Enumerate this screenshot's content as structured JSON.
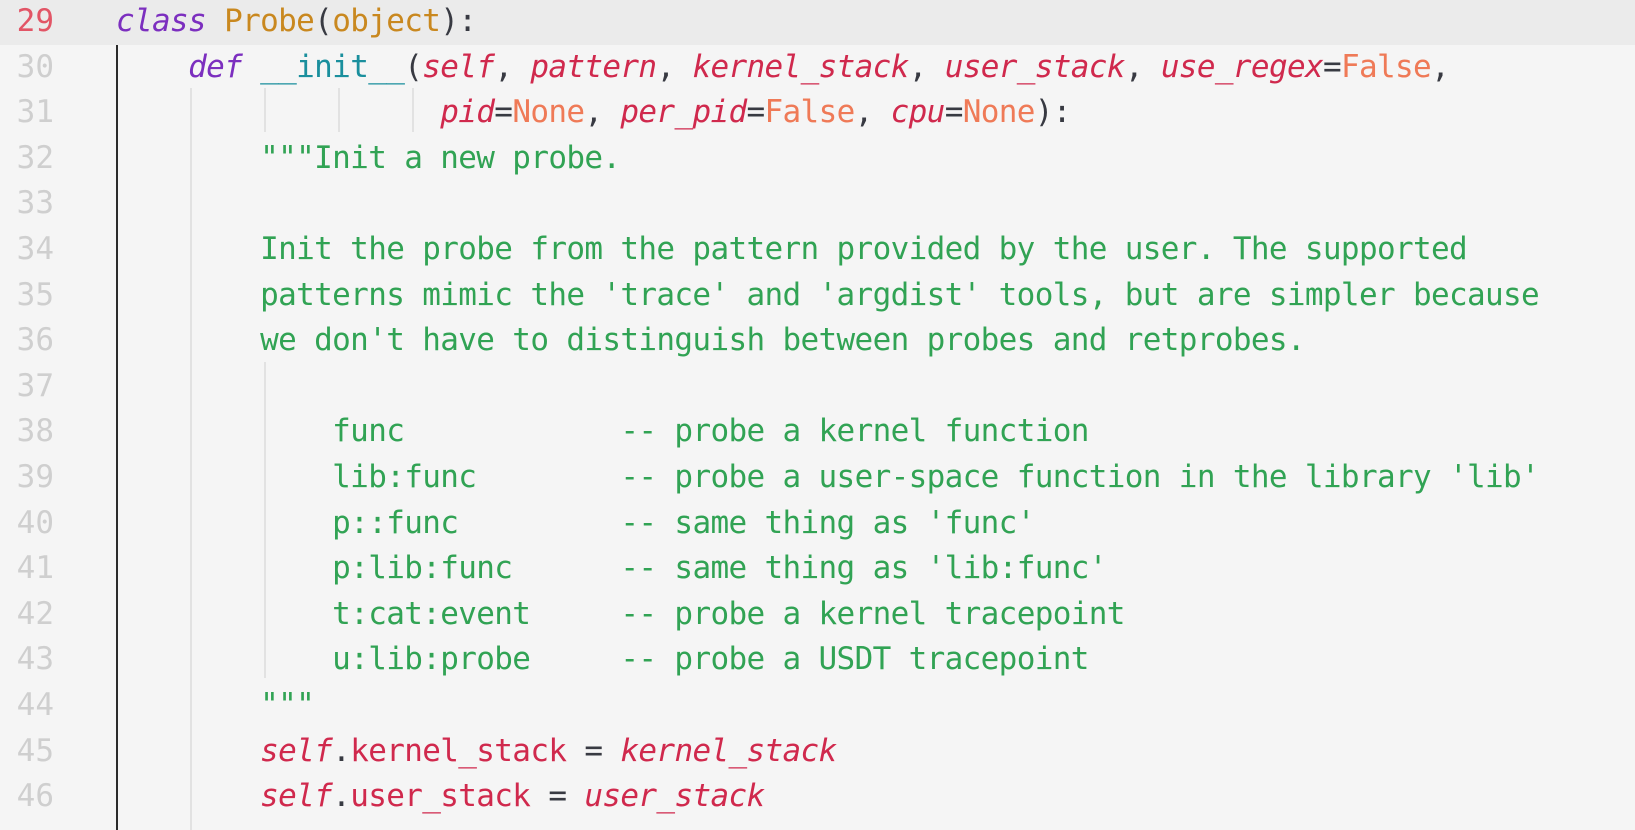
{
  "editor": {
    "active_line": 29,
    "lines": [
      {
        "num": "29",
        "tokens": [
          {
            "t": "class",
            "c": "kw"
          },
          {
            "t": " "
          },
          {
            "t": "Probe",
            "c": "cls"
          },
          {
            "t": "("
          },
          {
            "t": "object",
            "c": "cls"
          },
          {
            "t": "):"
          }
        ]
      },
      {
        "num": "30",
        "tokens": [
          {
            "t": "    "
          },
          {
            "t": "def",
            "c": "kw"
          },
          {
            "t": " "
          },
          {
            "t": "__init__",
            "c": "fn"
          },
          {
            "t": "("
          },
          {
            "t": "self",
            "c": "param"
          },
          {
            "t": ", "
          },
          {
            "t": "pattern",
            "c": "param"
          },
          {
            "t": ", "
          },
          {
            "t": "kernel_stack",
            "c": "param"
          },
          {
            "t": ", "
          },
          {
            "t": "user_stack",
            "c": "param"
          },
          {
            "t": ", "
          },
          {
            "t": "use_regex",
            "c": "param"
          },
          {
            "t": "="
          },
          {
            "t": "False",
            "c": "const"
          },
          {
            "t": ","
          }
        ]
      },
      {
        "num": "31",
        "tokens": [
          {
            "t": "                  "
          },
          {
            "t": "pid",
            "c": "param"
          },
          {
            "t": "="
          },
          {
            "t": "None",
            "c": "const"
          },
          {
            "t": ", "
          },
          {
            "t": "per_pid",
            "c": "param"
          },
          {
            "t": "="
          },
          {
            "t": "False",
            "c": "const"
          },
          {
            "t": ", "
          },
          {
            "t": "cpu",
            "c": "param"
          },
          {
            "t": "="
          },
          {
            "t": "None",
            "c": "const"
          },
          {
            "t": "):"
          }
        ]
      },
      {
        "num": "32",
        "tokens": [
          {
            "t": "        "
          },
          {
            "t": "\"\"\"Init a new probe.",
            "c": "str"
          }
        ]
      },
      {
        "num": "33",
        "tokens": []
      },
      {
        "num": "34",
        "tokens": [
          {
            "t": "        "
          },
          {
            "t": "Init the probe from the pattern provided by the user. The supported",
            "c": "str"
          }
        ]
      },
      {
        "num": "35",
        "tokens": [
          {
            "t": "        "
          },
          {
            "t": "patterns mimic the 'trace' and 'argdist' tools, but are simpler because",
            "c": "str"
          }
        ]
      },
      {
        "num": "36",
        "tokens": [
          {
            "t": "        "
          },
          {
            "t": "we don't have to distinguish between probes and retprobes.",
            "c": "str"
          }
        ]
      },
      {
        "num": "37",
        "tokens": []
      },
      {
        "num": "38",
        "tokens": [
          {
            "t": "            "
          },
          {
            "t": "func            -- probe a kernel function",
            "c": "str"
          }
        ]
      },
      {
        "num": "39",
        "tokens": [
          {
            "t": "            "
          },
          {
            "t": "lib:func        -- probe a user-space function in the library 'lib'",
            "c": "str"
          }
        ]
      },
      {
        "num": "40",
        "tokens": [
          {
            "t": "            "
          },
          {
            "t": "p::func         -- same thing as 'func'",
            "c": "str"
          }
        ]
      },
      {
        "num": "41",
        "tokens": [
          {
            "t": "            "
          },
          {
            "t": "p:lib:func      -- same thing as 'lib:func'",
            "c": "str"
          }
        ]
      },
      {
        "num": "42",
        "tokens": [
          {
            "t": "            "
          },
          {
            "t": "t:cat:event     -- probe a kernel tracepoint",
            "c": "str"
          }
        ]
      },
      {
        "num": "43",
        "tokens": [
          {
            "t": "            "
          },
          {
            "t": "u:lib:probe     -- probe a USDT tracepoint",
            "c": "str"
          }
        ]
      },
      {
        "num": "44",
        "tokens": [
          {
            "t": "        "
          },
          {
            "t": "\"\"\"",
            "c": "str"
          }
        ]
      },
      {
        "num": "45",
        "tokens": [
          {
            "t": "        "
          },
          {
            "t": "self",
            "c": "param"
          },
          {
            "t": "."
          },
          {
            "t": "kernel_stack",
            "c": "attr"
          },
          {
            "t": " = "
          },
          {
            "t": "kernel_stack",
            "c": "param"
          }
        ]
      },
      {
        "num": "46",
        "tokens": [
          {
            "t": "        "
          },
          {
            "t": "self",
            "c": "param"
          },
          {
            "t": "."
          },
          {
            "t": "user_stack",
            "c": "attr"
          },
          {
            "t": " = "
          },
          {
            "t": "user_stack",
            "c": "param"
          }
        ]
      }
    ]
  }
}
